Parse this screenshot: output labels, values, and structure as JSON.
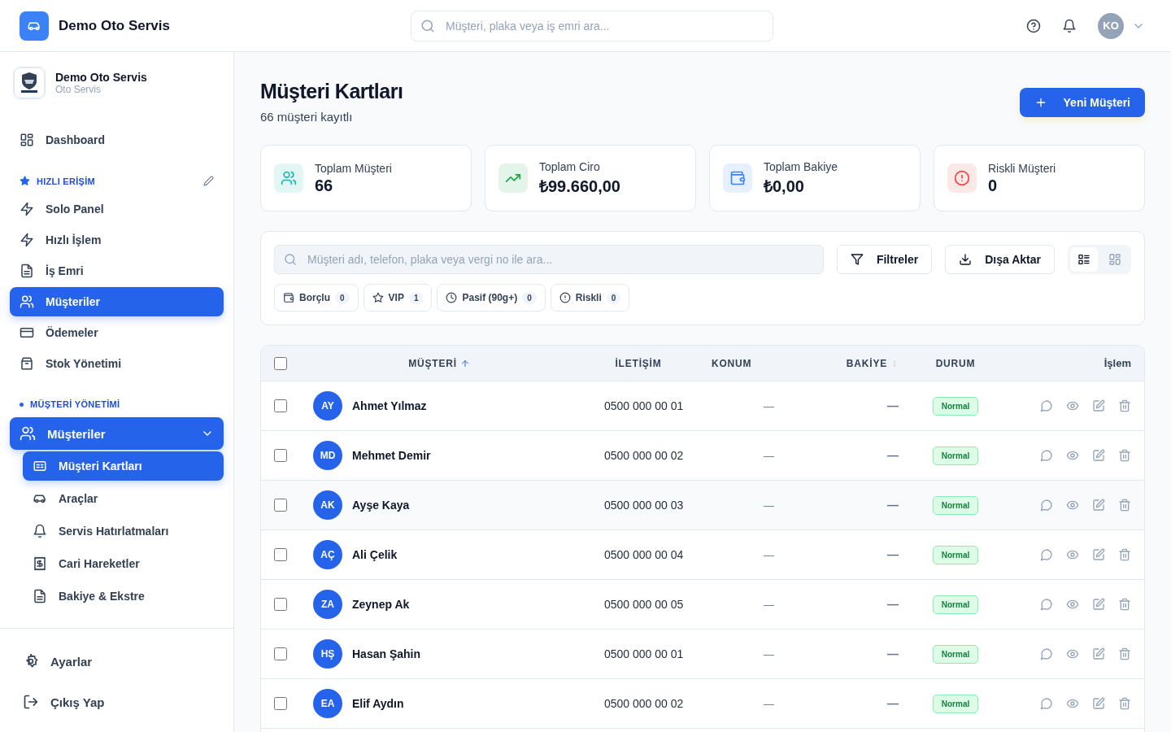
{
  "header": {
    "brand": "Demo Oto Servis",
    "search": {
      "placeholder": "Müşteri, plaka veya iş emri ara..."
    },
    "avatar": "KO"
  },
  "sidebar": {
    "company": {
      "name": "Demo Oto Servis",
      "subtitle": "Oto Servis"
    },
    "top_items": [
      {
        "label": "Dashboard",
        "selected": false
      }
    ],
    "sections": [
      {
        "title": "HIZLI ERİŞİM",
        "editable": true,
        "items": [
          {
            "label": "Solo Panel",
            "selected": false
          },
          {
            "label": "Hızlı İşlem",
            "selected": false
          },
          {
            "label": "İş Emri",
            "selected": false
          },
          {
            "label": "Müşteriler",
            "selected": true
          },
          {
            "label": "Ödemeler",
            "selected": false
          },
          {
            "label": "Stok Yönetimi",
            "selected": false
          }
        ]
      },
      {
        "title": "MÜŞTERİ YÖNETİMİ",
        "editable": false,
        "items": [
          {
            "label": "Müşteriler",
            "selected": true,
            "expanded": true,
            "children": [
              {
                "label": "Müşteri Kartları",
                "selected": true
              },
              {
                "label": "Araçlar",
                "selected": false
              },
              {
                "label": "Servis Hatırlatmaları",
                "selected": false
              },
              {
                "label": "Cari Hareketler",
                "selected": false
              },
              {
                "label": "Bakiye & Ekstre",
                "selected": false
              }
            ]
          }
        ]
      }
    ],
    "footer": [
      {
        "label": "Ayarlar"
      },
      {
        "label": "Çıkış Yap"
      }
    ]
  },
  "page": {
    "title": "Müşteri Kartları",
    "subtitle": "66 müşteri kayıtlı",
    "new_button": "Yeni Müşteri"
  },
  "stats": [
    {
      "label": "Toplam Müşteri",
      "value": "66",
      "color": "#14b8a6"
    },
    {
      "label": "Toplam Ciro",
      "value": "₺99.660,00",
      "color": "#16a34a"
    },
    {
      "label": "Toplam Bakiye",
      "value": "₺0,00",
      "color": "#3b82f6"
    },
    {
      "label": "Riskli Müşteri",
      "value": "0",
      "color": "#ef4444"
    }
  ],
  "toolbar": {
    "search": {
      "placeholder": "Müşteri adı, telefon, plaka veya vergi no ile ara..."
    },
    "filter_button": "Filtreler",
    "export_button": "Dışa Aktar",
    "views": [
      {
        "selected": true
      },
      {
        "selected": false
      }
    ],
    "chips": [
      {
        "label": "Borçlu",
        "count": "0"
      },
      {
        "label": "VIP",
        "count": "1"
      },
      {
        "label": "Pasif (90g+)",
        "count": "0"
      },
      {
        "label": "Riskli",
        "count": "0"
      }
    ]
  },
  "table": {
    "select_all": {
      "checked": false
    },
    "columns": [
      {
        "label": "MÜŞTERİ",
        "sorted": true
      },
      {
        "label": "İLETİŞİM",
        "sorted": false,
        "sortable": false
      },
      {
        "label": "KONUM",
        "sorted": false,
        "sortable": false
      },
      {
        "label": "BAKİYE",
        "sorted": false,
        "sortable": true
      },
      {
        "label": "DURUM",
        "sorted": false,
        "sortable": false
      },
      {
        "label": "İşlem",
        "sorted": false,
        "sortable": false
      }
    ],
    "rows": [
      {
        "checked": false,
        "initials": "AY",
        "name": "Ahmet Yılmaz",
        "phone": "0500 000 00 01",
        "location": "—",
        "balance": "—",
        "status": "Normal"
      },
      {
        "checked": false,
        "initials": "MD",
        "name": "Mehmet Demir",
        "phone": "0500 000 00 02",
        "location": "—",
        "balance": "—",
        "status": "Normal"
      },
      {
        "checked": false,
        "initials": "AK",
        "name": "Ayşe Kaya",
        "phone": "0500 000 00 03",
        "location": "—",
        "balance": "—",
        "status": "Normal"
      },
      {
        "checked": false,
        "initials": "AÇ",
        "name": "Ali Çelik",
        "phone": "0500 000 00 04",
        "location": "—",
        "balance": "—",
        "status": "Normal"
      },
      {
        "checked": false,
        "initials": "ZA",
        "name": "Zeynep Ak",
        "phone": "0500 000 00 05",
        "location": "—",
        "balance": "—",
        "status": "Normal"
      },
      {
        "checked": false,
        "initials": "HŞ",
        "name": "Hasan Şahin",
        "phone": "0500 000 00 01",
        "location": "—",
        "balance": "—",
        "status": "Normal"
      },
      {
        "checked": false,
        "initials": "EA",
        "name": "Elif Aydın",
        "phone": "0500 000 00 02",
        "location": "—",
        "balance": "—",
        "status": "Normal"
      }
    ]
  }
}
